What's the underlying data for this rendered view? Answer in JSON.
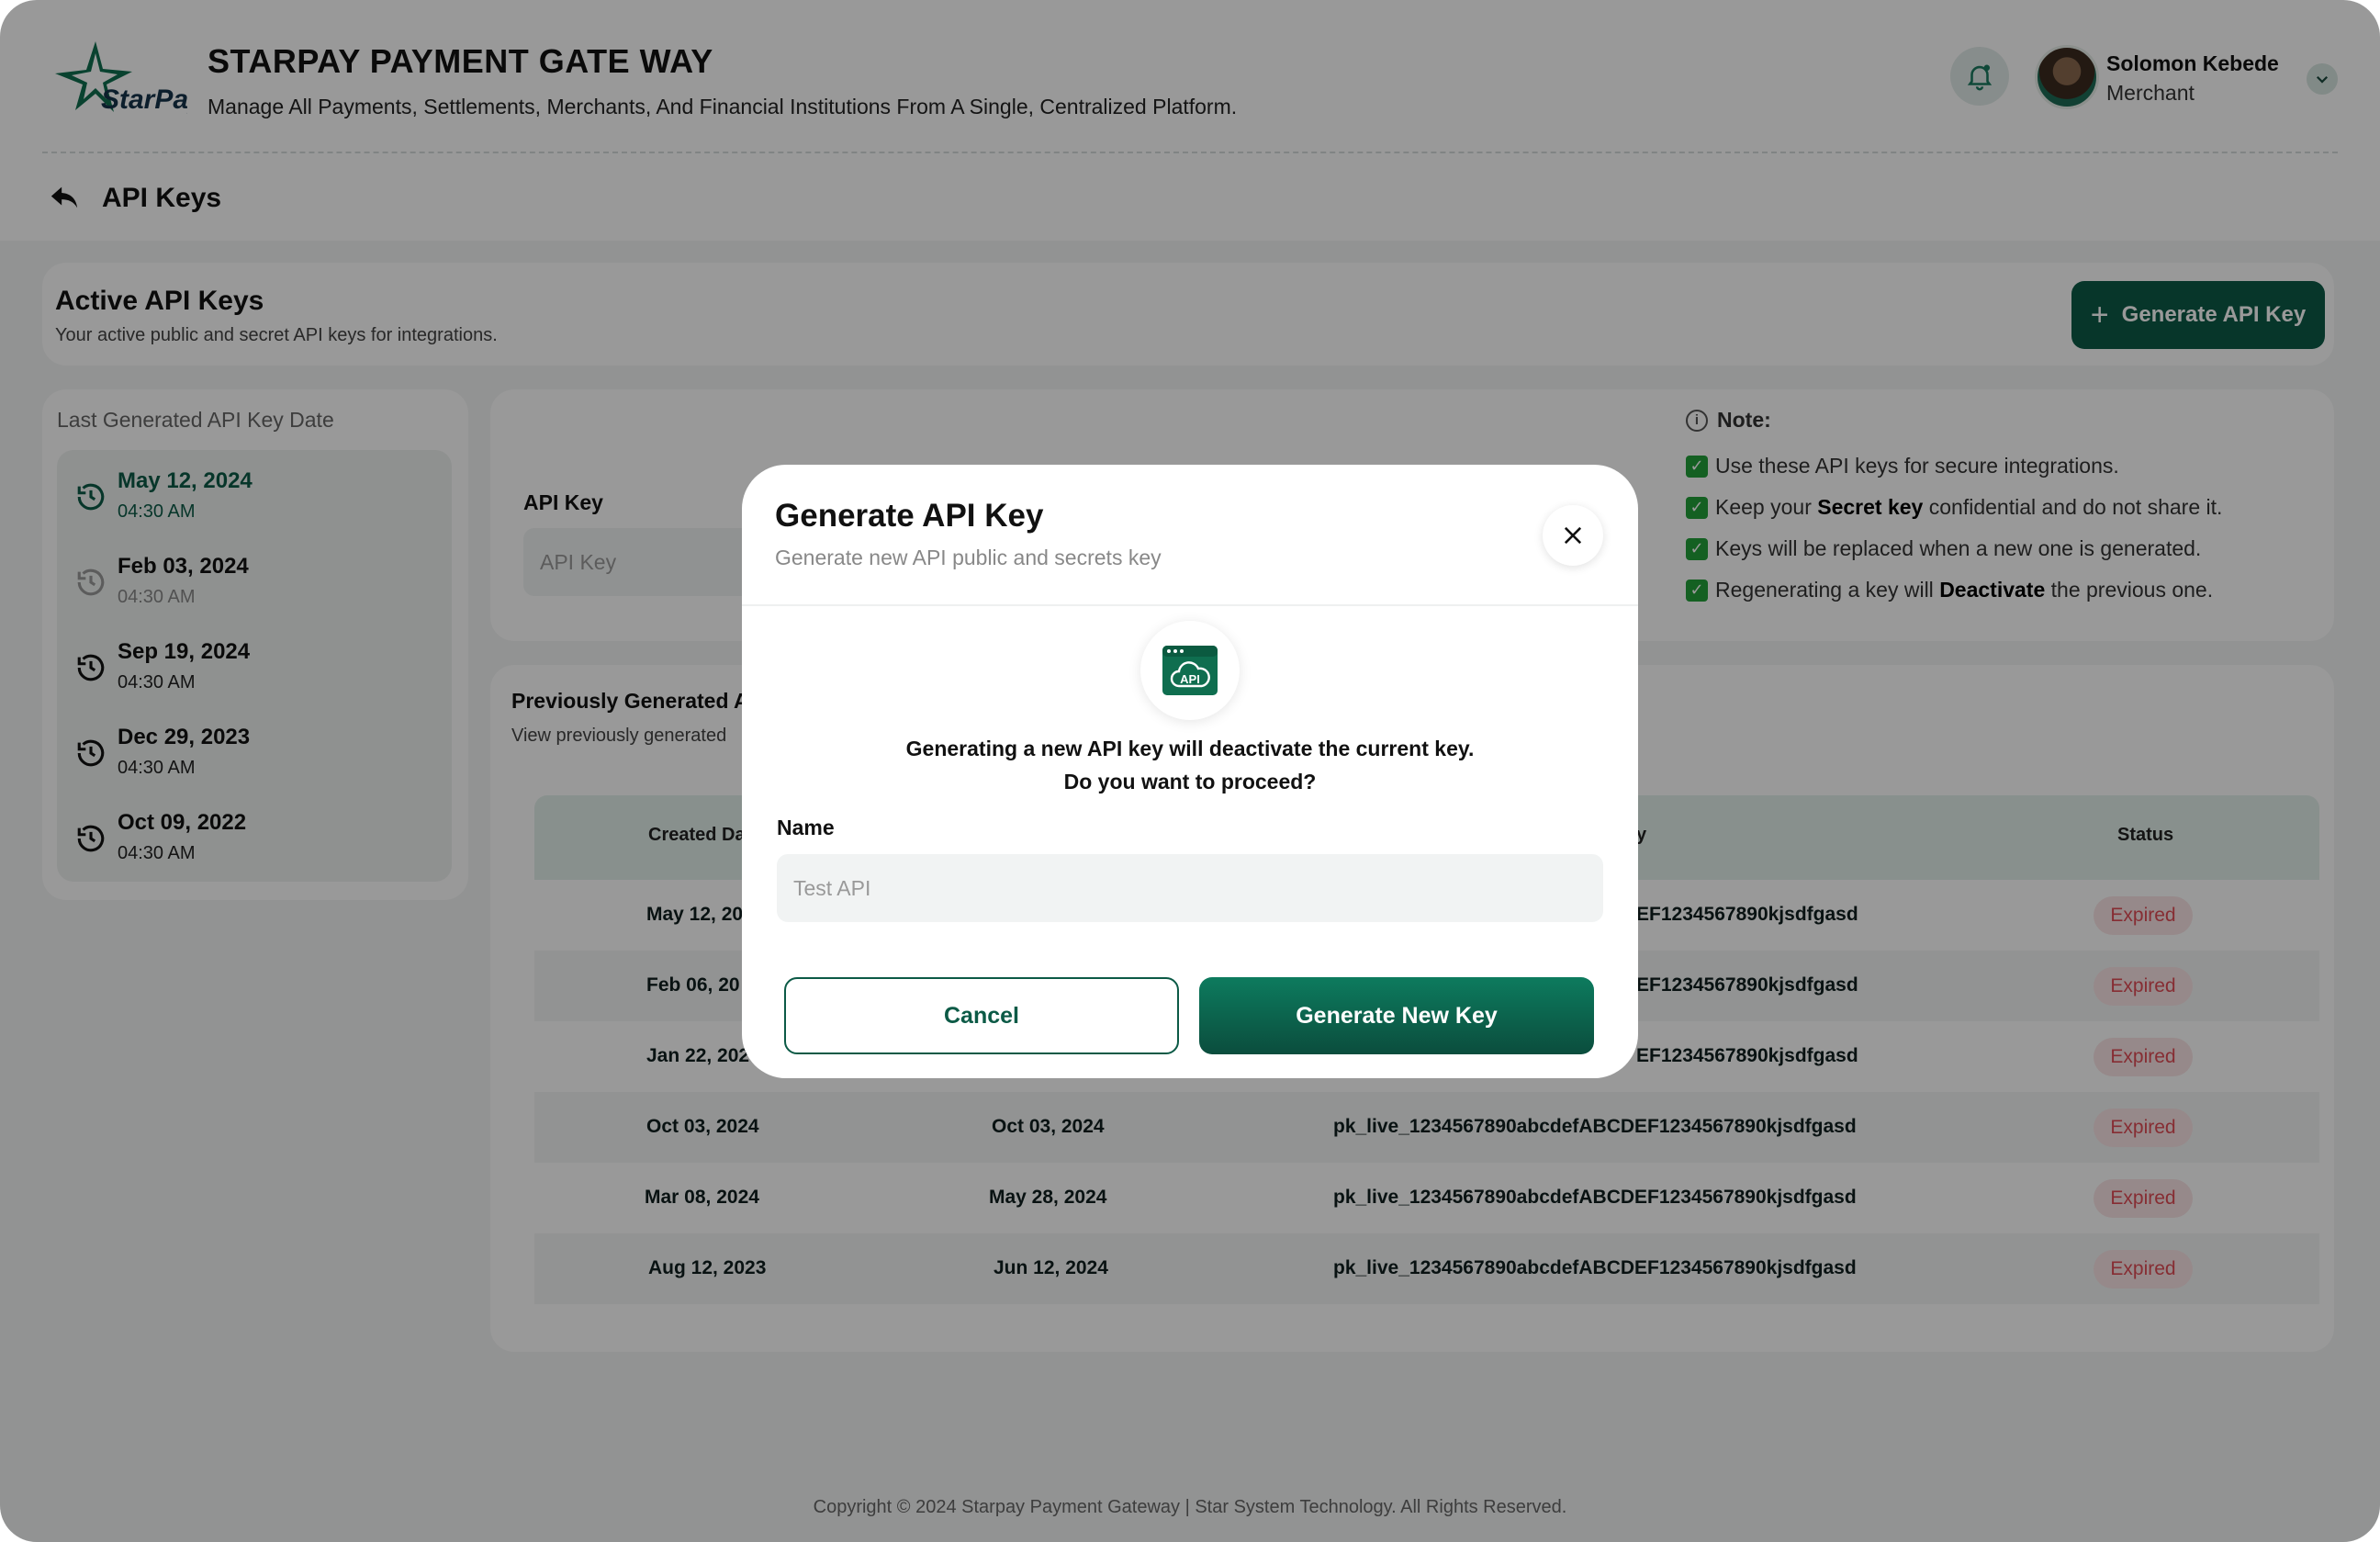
{
  "header": {
    "logo_text": "StarPay",
    "title": "STARPAY PAYMENT GATE WAY",
    "subtitle": "Manage All Payments, Settlements, Merchants, And Financial Institutions From A Single, Centralized Platform.",
    "user_name": "Solomon Kebede",
    "user_role": "Merchant"
  },
  "breadcrumb": {
    "title": "API Keys"
  },
  "active_card": {
    "title": "Active API Keys",
    "subtitle": "Your active public and secret API keys for integrations.",
    "generate_label": "Generate API Key"
  },
  "sidebar": {
    "title": "Last Generated API Key Date",
    "items": [
      {
        "date": "May 12, 2024",
        "time": "04:30 AM"
      },
      {
        "date": "Feb 03, 2024",
        "time": "04:30 AM"
      },
      {
        "date": "Sep 19, 2024",
        "time": "04:30 AM"
      },
      {
        "date": "Dec 29, 2023",
        "time": "04:30 AM"
      },
      {
        "date": "Oct 09, 2022",
        "time": "04:30 AM"
      }
    ]
  },
  "api_key": {
    "label": "API Key",
    "placeholder": "API Key"
  },
  "note": {
    "title": "Note:",
    "line1": "Use these API keys for secure integrations.",
    "line2_pre": "Keep your ",
    "line2_bold": "Secret key",
    "line2_post": " confidential and do not share it.",
    "line3": "Keys will be replaced when a new one is generated.",
    "line4_pre": "Regenerating a key will ",
    "line4_bold": "Deactivate",
    "line4_post": " the previous one."
  },
  "previous": {
    "title": "Previously Generated A",
    "subtitle": "View previously generated",
    "columns": {
      "created": "Created Da",
      "key": "y",
      "status": "Status"
    },
    "rows": [
      {
        "created": "May 12, 20",
        "expired": "",
        "key": "EF1234567890kjsdfgasd",
        "status": "Expired"
      },
      {
        "created": "Feb 06, 20",
        "expired": "",
        "key": "EF1234567890kjsdfgasd",
        "status": "Expired"
      },
      {
        "created": "Jan 22, 202",
        "expired": "",
        "key": "EF1234567890kjsdfgasd",
        "status": "Expired"
      },
      {
        "created": "Oct 03, 2024",
        "expired": "Oct 03, 2024",
        "key": "pk_live_1234567890abcdefABCDEF1234567890kjsdfgasd",
        "status": "Expired"
      },
      {
        "created": "Mar 08, 2024",
        "expired": "May 28, 2024",
        "key": "pk_live_1234567890abcdefABCDEF1234567890kjsdfgasd",
        "status": "Expired"
      },
      {
        "created": "Aug 12, 2023",
        "expired": "Jun 12, 2024",
        "key": "pk_live_1234567890abcdefABCDEF1234567890kjsdfgasd",
        "status": "Expired"
      }
    ]
  },
  "footer": {
    "text": "Copyright © 2024 Starpay Payment Gateway | Star System Technology. All Rights Reserved."
  },
  "modal": {
    "title": "Generate API Key",
    "subtitle": "Generate new API public and secrets key",
    "icon_text": "API",
    "message_line1": "Generating a new API key will deactivate the current key.",
    "message_line2": "Do you want to proceed?",
    "name_label": "Name",
    "name_placeholder": "Test API",
    "cancel_label": "Cancel",
    "confirm_label": "Generate New Key"
  },
  "colors": {
    "brand": "#0c5a46",
    "status_expired_text": "#e04b55",
    "status_expired_bg": "#fbe5e6",
    "check": "#22a03a"
  },
  "icons": [
    "star-logo",
    "bell-icon",
    "chevron-down-icon",
    "back-arrow-icon",
    "plus-icon",
    "history-icon",
    "info-icon",
    "checkbox-icon",
    "close-icon",
    "api-cloud-icon"
  ]
}
